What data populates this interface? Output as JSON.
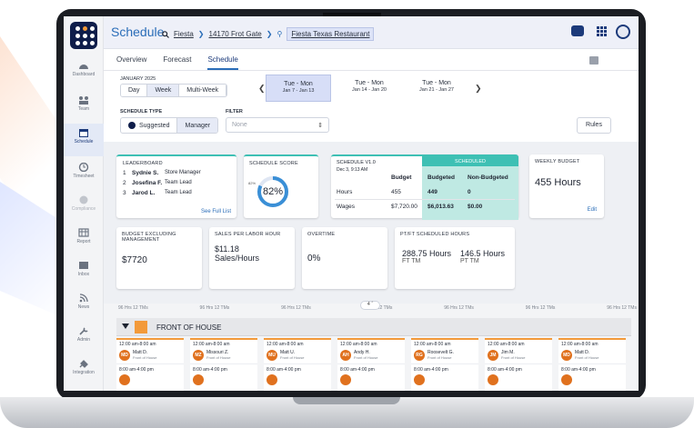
{
  "app": {
    "title": "Schedule"
  },
  "breadcrumb": {
    "org": "Fiesta",
    "address": "14170 Frot Gate",
    "restaurant": "Fiesta Texas Restaurant"
  },
  "leftnav": [
    {
      "label": "Dashboard",
      "icon": "dashboard-icon"
    },
    {
      "label": "Team",
      "icon": "team-icon"
    },
    {
      "label": "Schedule",
      "icon": "calendar-icon"
    },
    {
      "label": "Timesheet",
      "icon": "clock-icon"
    },
    {
      "label": "Compliance",
      "icon": "info-icon"
    },
    {
      "label": "Report",
      "icon": "report-icon"
    },
    {
      "label": "Inbox",
      "icon": "mail-icon"
    },
    {
      "label": "News",
      "icon": "rss-icon"
    },
    {
      "label": "Admin",
      "icon": "wrench-icon"
    },
    {
      "label": "Integration",
      "icon": "plug-icon"
    }
  ],
  "tabs": [
    "Overview",
    "Forecast",
    "Schedule"
  ],
  "month": "JANUARY 2025",
  "views": [
    "Day",
    "Week",
    "Multi-Week"
  ],
  "weeks": [
    {
      "label": "Tue - Mon",
      "range": "Jan 7 - Jan 13"
    },
    {
      "label": "Tue - Mon",
      "range": "Jan 14 - Jan 20"
    },
    {
      "label": "Tue - Mon",
      "range": "Jan 21 - Jan 27"
    }
  ],
  "schedule_type": {
    "label": "SCHEDULE TYPE",
    "options": [
      "Suggested",
      "Manager"
    ],
    "suggested_badge": "S"
  },
  "filter": {
    "label": "FILTER",
    "placeholder": "None"
  },
  "rules_label": "Rules",
  "leaderboard": {
    "title": "LEADERBOARD",
    "rows": [
      {
        "rank": "1",
        "name": "Sydnie S.",
        "role": "Store Manager"
      },
      {
        "rank": "2",
        "name": "Josefina F.",
        "role": "Team Lead"
      },
      {
        "rank": "3",
        "name": "Jarod L.",
        "role": "Team Lead"
      }
    ],
    "see_full": "See Full List"
  },
  "schedule_score": {
    "title": "SCHEDULE SCORE",
    "value": "82%",
    "small": "82%",
    "fraction": 0.82
  },
  "schedule_version": {
    "title": "SCHEDULE V1.0",
    "date": "Dec 3, 9:13 AM",
    "budget_header": "Budget",
    "scheduled_header": "SCHEDULED",
    "budgeted_header": "Budgeted",
    "nonbudgeted_header": "Non-Budgeted",
    "rows": [
      {
        "label": "Hours",
        "budget": "455",
        "budgeted": "449",
        "nonbudgeted": "0"
      },
      {
        "label": "Wages",
        "budget": "$7,720.00",
        "budgeted": "$6,013.63",
        "nonbudgeted": "$0.00"
      }
    ]
  },
  "weekly_budget": {
    "title": "WEEKLY BUDGET",
    "value": "455 Hours",
    "edit": "Edit"
  },
  "budget_excl": {
    "title": "BUDGET EXCLUDING MANAGEMENT",
    "value": "$7720"
  },
  "sales_labor": {
    "title": "SALES PER LABOR HOUR",
    "value": "$11.18",
    "unit": "Sales/Hours"
  },
  "overtime": {
    "title": "OVERTIME",
    "value": "0%"
  },
  "ptft": {
    "title": "PT/FT SCHEDULED HOURS",
    "pt": "288.75 Hours",
    "pt_sub": "FT TM",
    "ft": "146.5 Hours",
    "ft_sub": "PT TM"
  },
  "hrs_summary": [
    "96 Hrs   12 TMs",
    "96 Hrs   12 TMs",
    "96 Hrs   12 TMs",
    "96 Hrs   12 TMs",
    "96 Hrs   12 TMs",
    "96 Hrs   12 TMs",
    "96 Hrs   12 TMs"
  ],
  "collapse_count": "4",
  "section": {
    "label": "FRONT OF HOUSE",
    "color": "#f39a3a"
  },
  "shifts": [
    {
      "time": "12:00 am-8:00 am",
      "initials": "MD",
      "name": "Matt D.",
      "role": "Front of House",
      "time2": "8:00 am-4:00 pm"
    },
    {
      "time": "12:00 am-8:00 am",
      "initials": "MZ",
      "name": "Missouri Z.",
      "role": "Front of House",
      "time2": "8:00 am-4:00 pm"
    },
    {
      "time": "12:00 am-8:00 am",
      "initials": "MU",
      "name": "Matt U.",
      "role": "Front of House",
      "time2": "8:00 am-4:00 pm"
    },
    {
      "time": "12:00 am-8:00 am",
      "initials": "AH",
      "name": "Andy H.",
      "role": "Front of House",
      "time2": "8:00 am-4:00 pm"
    },
    {
      "time": "12:00 am-8:00 am",
      "initials": "RG",
      "name": "Roosevelt G.",
      "role": "Front of House",
      "time2": "8:00 am-4:00 pm"
    },
    {
      "time": "12:00 am-8:00 am",
      "initials": "JM",
      "name": "Jim M.",
      "role": "Front of House",
      "time2": "8:00 am-4:00 pm"
    },
    {
      "time": "12:00 am-8:00 am",
      "initials": "MD",
      "name": "Matt D.",
      "role": "Front of House",
      "time2": "8:00 am-4:00 pm"
    }
  ],
  "colors": {
    "brand_navy": "#0f1d4a",
    "accent_blue": "#2a6db8",
    "teal": "#3ec0b4",
    "orange": "#f39a3a"
  }
}
